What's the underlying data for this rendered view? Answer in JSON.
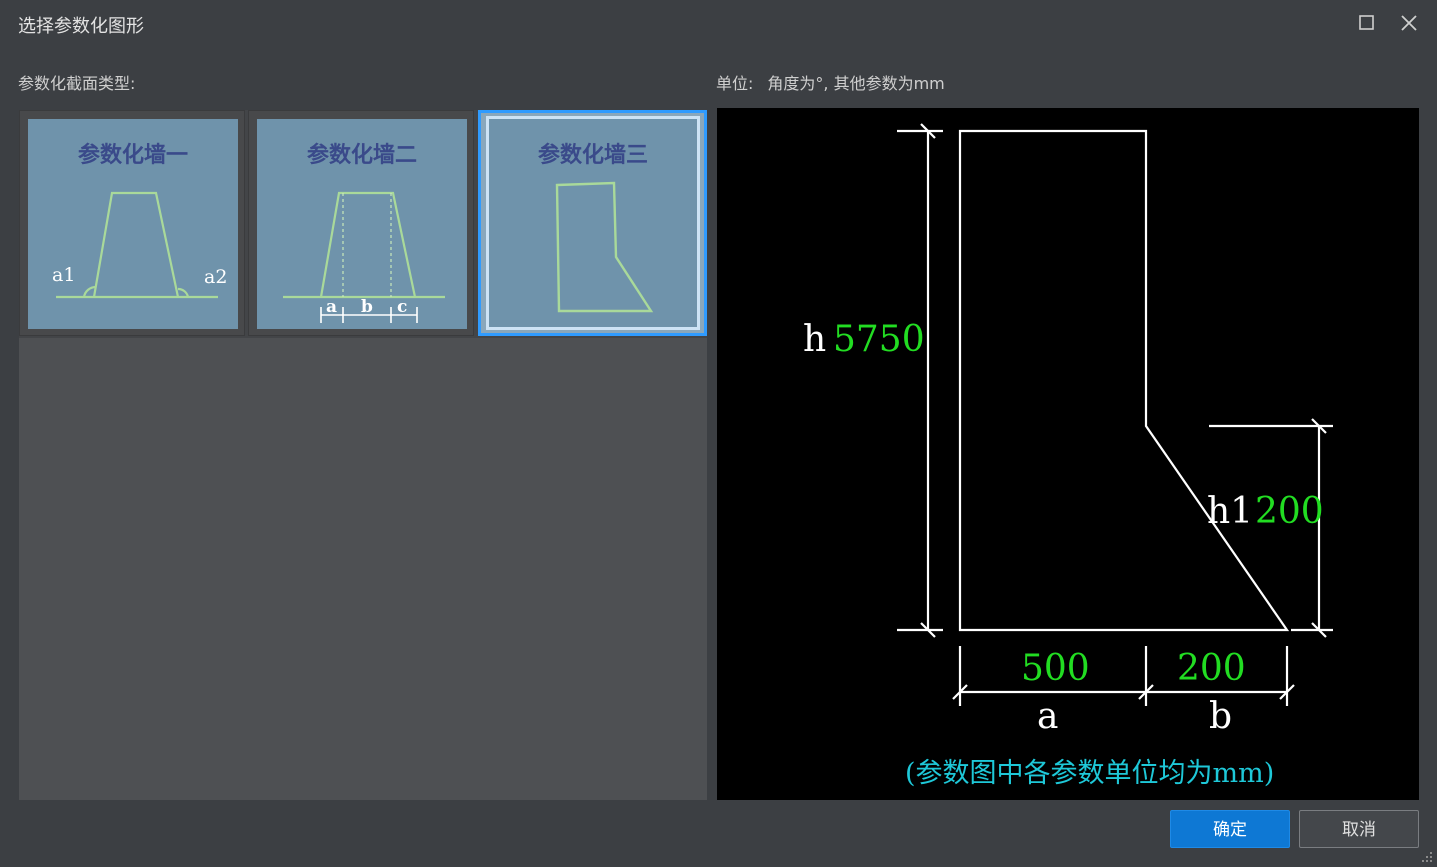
{
  "window": {
    "title": "选择参数化图形",
    "maximize_icon": "maximize-icon",
    "close_icon": "close-icon"
  },
  "labels": {
    "section_type": "参数化截面类型:",
    "unit_label": "单位:",
    "unit_text": "角度为°, 其他参数为mm"
  },
  "thumbnails": [
    {
      "caption": "参数化墙一",
      "dims": [
        "a1",
        "a2"
      ],
      "selected": false
    },
    {
      "caption": "参数化墙二",
      "dims": [
        "a",
        "b",
        "c"
      ],
      "selected": false
    },
    {
      "caption": "参数化墙三",
      "dims": [],
      "selected": true
    }
  ],
  "preview": {
    "h_label": "h",
    "h_value": "5750",
    "h1_label": "h1",
    "h1_value": "200",
    "a_label": "a",
    "a_value": "500",
    "b_label": "b",
    "b_value": "200",
    "note": "(参数图中各参数单位均为mm)",
    "colors": {
      "label": "#ffffff",
      "value": "#22dd22",
      "note": "#1ec8d8",
      "line": "#ffffff"
    }
  },
  "buttons": {
    "ok": "确定",
    "cancel": "取消"
  }
}
